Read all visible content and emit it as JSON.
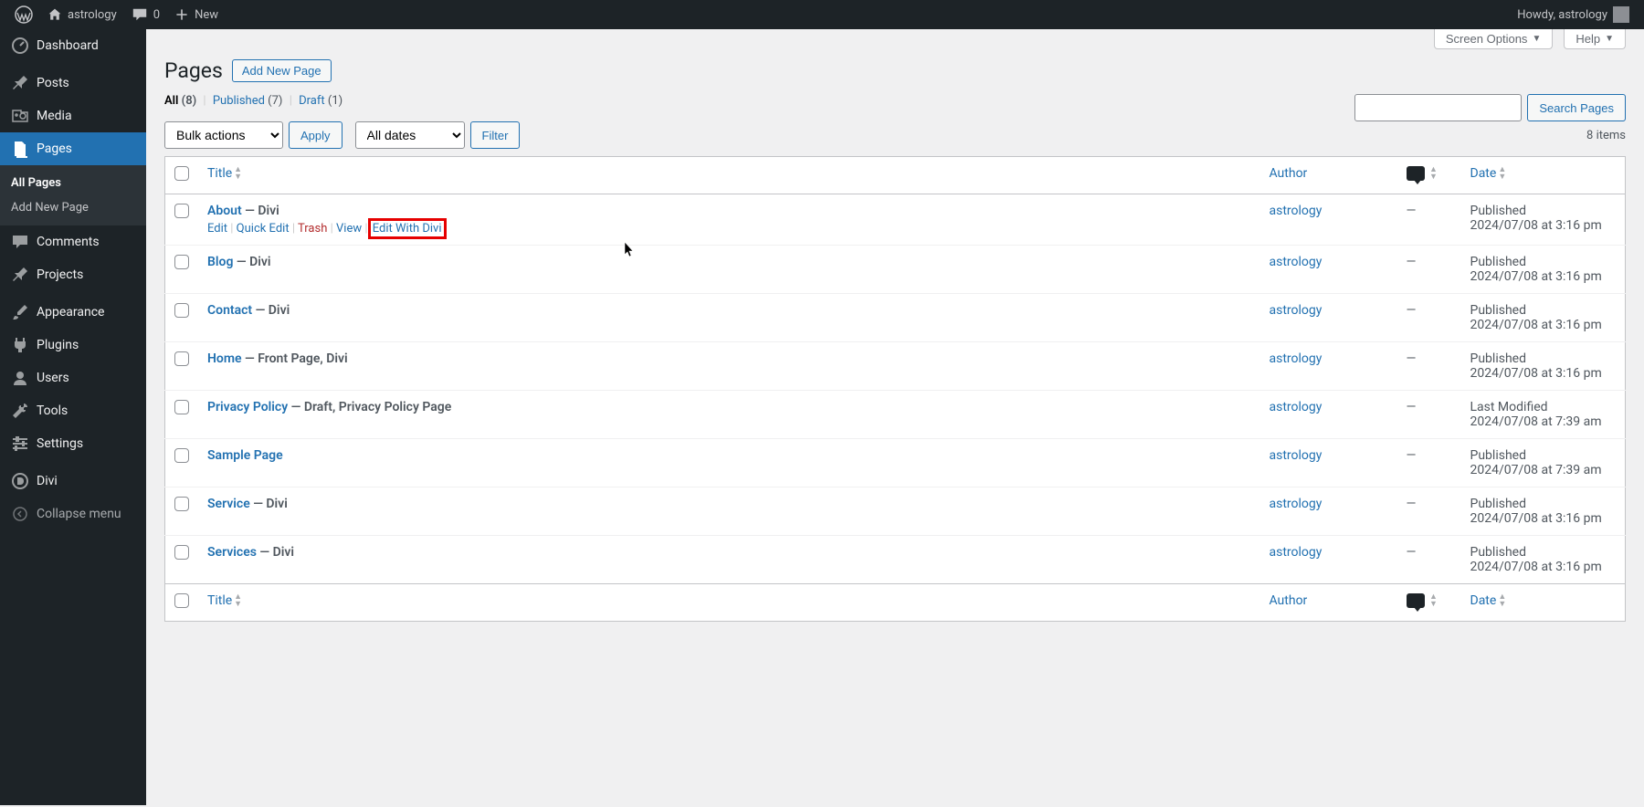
{
  "toolbar": {
    "site_name": "astrology",
    "comments_count": "0",
    "new_label": "New",
    "howdy": "Howdy, astrology"
  },
  "sidebar": {
    "items": [
      {
        "label": "Dashboard",
        "icon": "dashboard"
      },
      {
        "label": "Posts",
        "icon": "pin"
      },
      {
        "label": "Media",
        "icon": "media"
      },
      {
        "label": "Pages",
        "icon": "pages",
        "current": true
      },
      {
        "label": "Comments",
        "icon": "comment"
      },
      {
        "label": "Projects",
        "icon": "pin"
      },
      {
        "label": "Appearance",
        "icon": "brush"
      },
      {
        "label": "Plugins",
        "icon": "plugin"
      },
      {
        "label": "Users",
        "icon": "user"
      },
      {
        "label": "Tools",
        "icon": "wrench"
      },
      {
        "label": "Settings",
        "icon": "sliders"
      },
      {
        "label": "Divi",
        "icon": "divi"
      },
      {
        "label": "Collapse menu",
        "icon": "collapse"
      }
    ],
    "submenu": {
      "all_pages": "All Pages",
      "add_new": "Add New Page"
    }
  },
  "screen_meta": {
    "screen_options": "Screen Options",
    "help": "Help"
  },
  "header": {
    "title": "Pages",
    "add_new": "Add New Page"
  },
  "filters": {
    "links": {
      "all_label": "All",
      "all_count": "(8)",
      "published_label": "Published",
      "published_count": "(7)",
      "draft_label": "Draft",
      "draft_count": "(1)"
    },
    "bulk_actions": "Bulk actions",
    "apply": "Apply",
    "all_dates": "All dates",
    "filter": "Filter",
    "search_button": "Search Pages",
    "items_count": "8 items"
  },
  "columns": {
    "title": "Title",
    "author": "Author",
    "date": "Date"
  },
  "row_actions": {
    "edit": "Edit",
    "quick_edit": "Quick Edit",
    "trash": "Trash",
    "view": "View",
    "edit_with_divi": "Edit With Divi"
  },
  "rows": [
    {
      "title": "About",
      "state": " — Divi",
      "author": "astrology",
      "comments": "—",
      "date_status": "Published",
      "date_time": "2024/07/08 at 3:16 pm",
      "show_actions": true
    },
    {
      "title": "Blog",
      "state": " — Divi",
      "author": "astrology",
      "comments": "—",
      "date_status": "Published",
      "date_time": "2024/07/08 at 3:16 pm"
    },
    {
      "title": "Contact",
      "state": " — Divi",
      "author": "astrology",
      "comments": "—",
      "date_status": "Published",
      "date_time": "2024/07/08 at 3:16 pm"
    },
    {
      "title": "Home",
      "state": " — Front Page, Divi",
      "author": "astrology",
      "comments": "—",
      "date_status": "Published",
      "date_time": "2024/07/08 at 3:16 pm"
    },
    {
      "title": "Privacy Policy",
      "state": " — Draft, Privacy Policy Page",
      "author": "astrology",
      "comments": "—",
      "date_status": "Last Modified",
      "date_time": "2024/07/08 at 7:39 am"
    },
    {
      "title": "Sample Page",
      "state": "",
      "author": "astrology",
      "comments": "—",
      "date_status": "Published",
      "date_time": "2024/07/08 at 7:39 am"
    },
    {
      "title": "Service",
      "state": " — Divi",
      "author": "astrology",
      "comments": "—",
      "date_status": "Published",
      "date_time": "2024/07/08 at 3:16 pm"
    },
    {
      "title": "Services",
      "state": " — Divi",
      "author": "astrology",
      "comments": "—",
      "date_status": "Published",
      "date_time": "2024/07/08 at 3:16 pm"
    }
  ]
}
